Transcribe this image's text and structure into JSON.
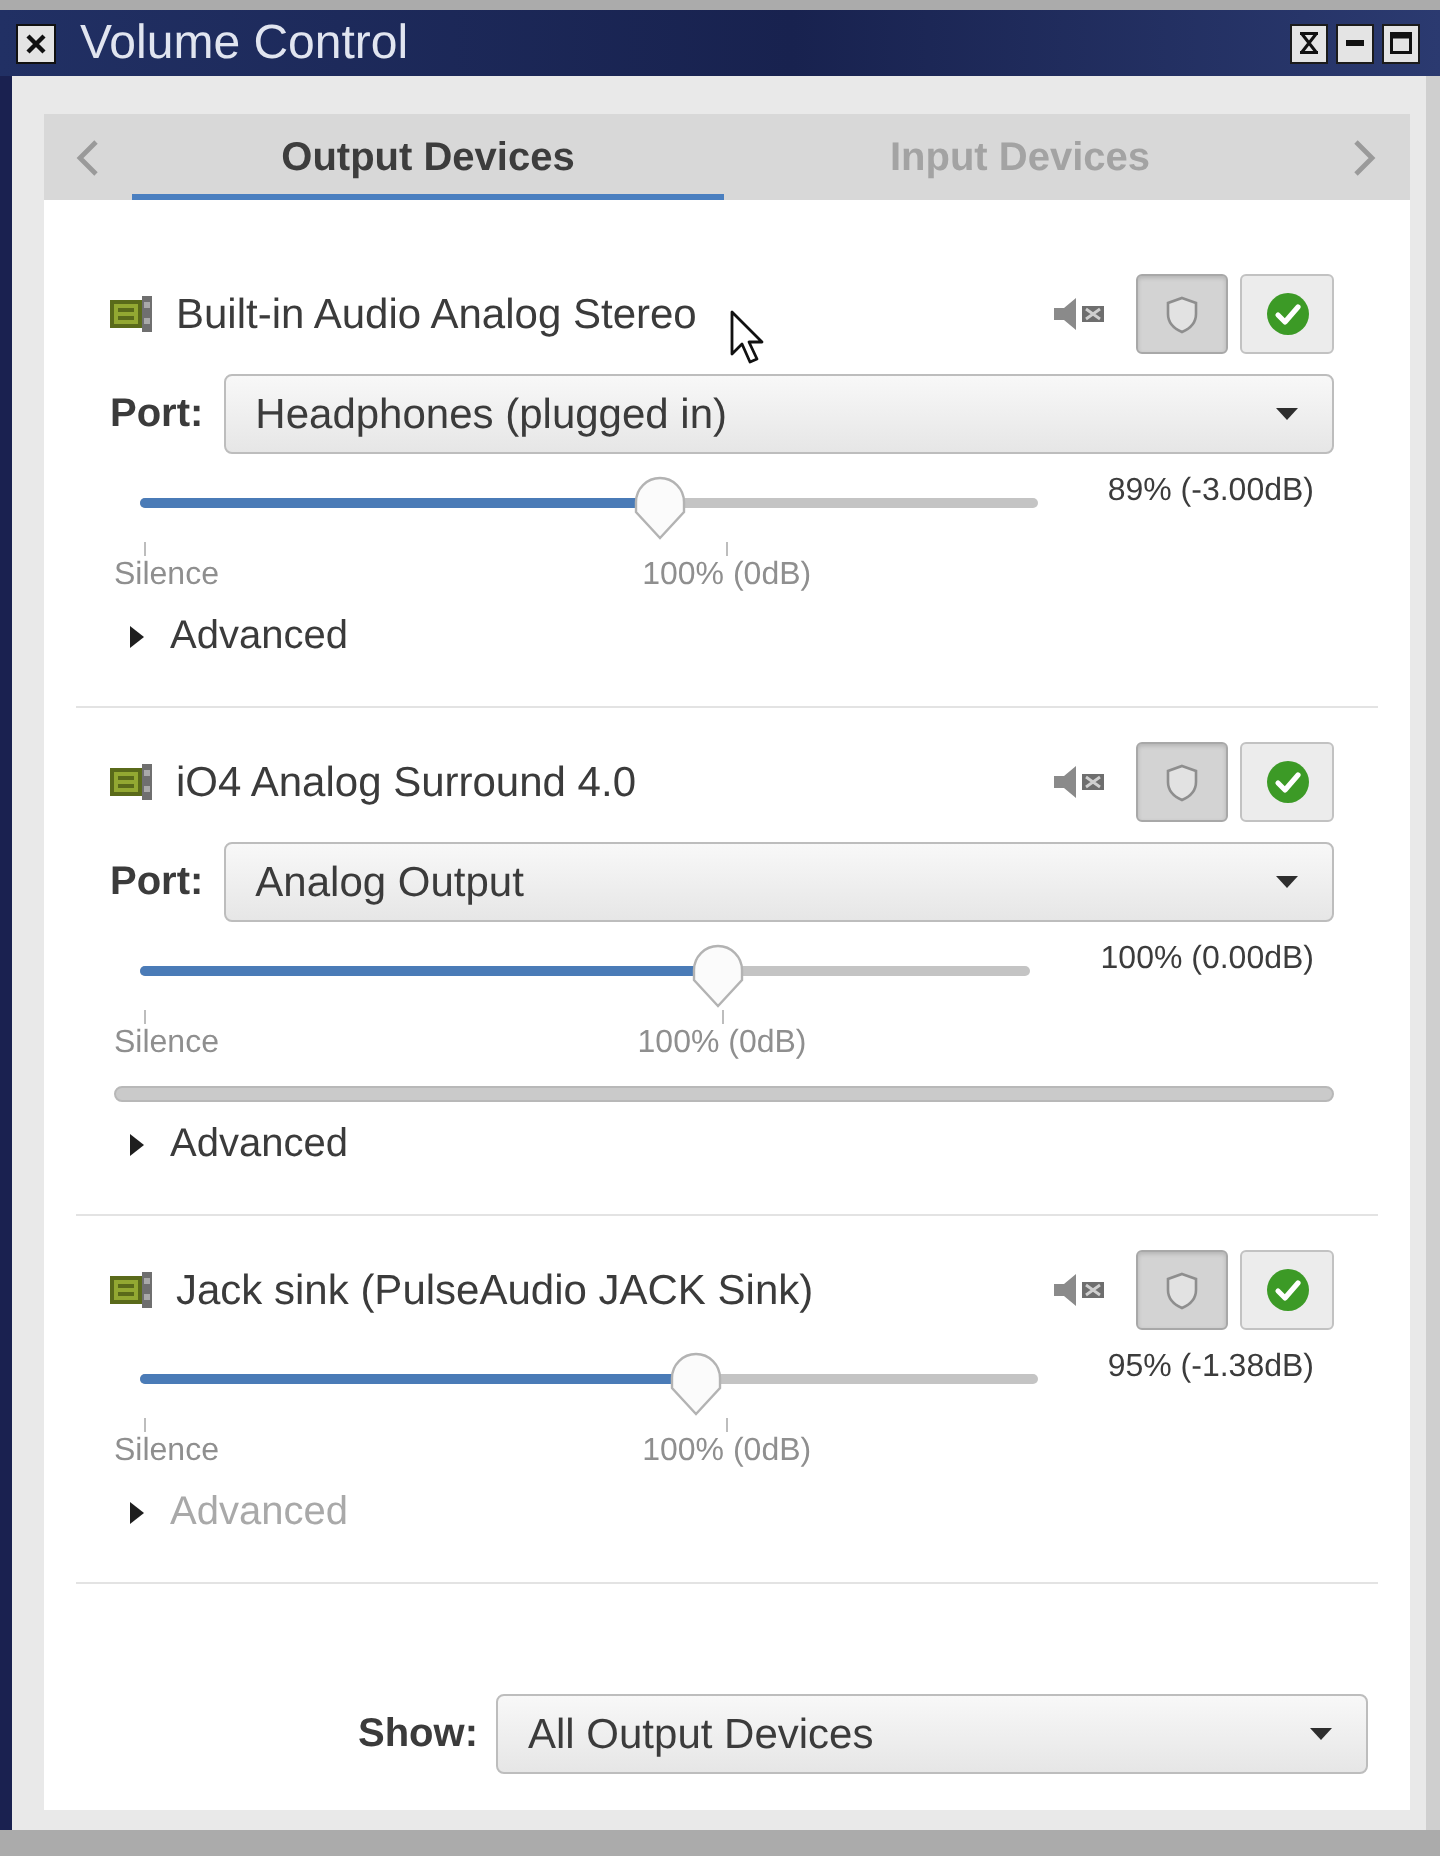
{
  "window": {
    "title": "Volume Control"
  },
  "tabs": [
    {
      "label": "Output Devices",
      "selected": true
    },
    {
      "label": "Input Devices",
      "selected": false
    }
  ],
  "devices": [
    {
      "name": "Built-in Audio Analog Stereo",
      "locked": true,
      "port": {
        "label": "Port:",
        "value": "Headphones (plugged in)"
      },
      "volume": {
        "level": 0.58,
        "reading": "89% (-3.00dB)",
        "marks": [
          "Silence",
          "100% (0dB)"
        ]
      },
      "advanced": {
        "label": "Advanced",
        "expanded": false,
        "disabled": false
      }
    },
    {
      "name": "iO4 Analog Surround 4.0",
      "locked": true,
      "port": {
        "label": "Port:",
        "value": "Analog Output"
      },
      "volume": {
        "level": 0.65,
        "reading": "100% (0.00dB)",
        "marks": [
          "Silence",
          "100% (0dB)"
        ]
      },
      "peak_meter": true,
      "advanced": {
        "label": "Advanced",
        "expanded": false,
        "disabled": false
      }
    },
    {
      "name": "Jack sink (PulseAudio JACK Sink)",
      "locked": true,
      "volume": {
        "level": 0.62,
        "reading": "95% (-1.38dB)",
        "marks": [
          "Silence",
          "100% (0dB)"
        ]
      },
      "advanced": {
        "label": "Advanced",
        "expanded": false,
        "disabled": true
      }
    }
  ],
  "show": {
    "label": "Show:",
    "value": "All Output Devices"
  }
}
